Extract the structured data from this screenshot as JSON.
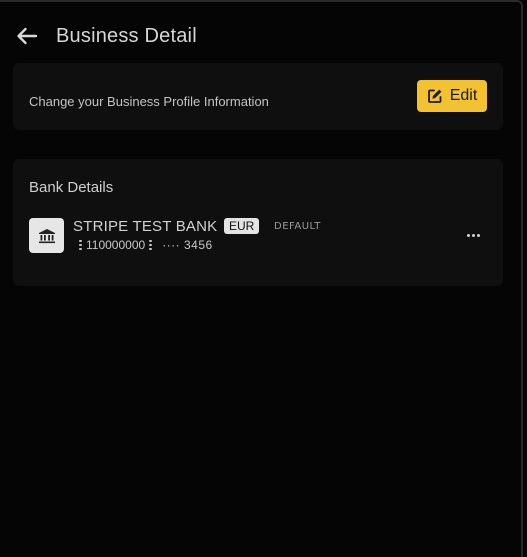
{
  "header": {
    "title": "Business Detail",
    "back_icon": "arrow-left-icon"
  },
  "profile_card": {
    "description": "Change your Business Profile Information",
    "edit_label": "Edit",
    "edit_icon": "edit-icon",
    "accent_color": "#f2c230"
  },
  "bank_card": {
    "heading": "Bank Details",
    "accounts": [
      {
        "icon": "bank-icon",
        "name": "STRIPE TEST BANK",
        "currency": "EUR",
        "status": "DEFAULT",
        "routing_number": "110000000",
        "account_masked": "···· 3456",
        "menu_icon": "more-horizontal-icon"
      }
    ]
  }
}
